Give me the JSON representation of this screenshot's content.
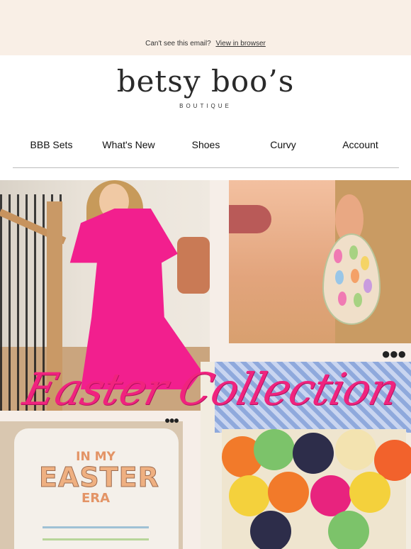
{
  "preheader": {
    "text": "Can't see this email?",
    "link": "View in browser"
  },
  "brand": {
    "name": "betsy boo’s",
    "tagline": "BOUTIQUE"
  },
  "nav": {
    "items": [
      {
        "label": "BBB Sets"
      },
      {
        "label": "What's New"
      },
      {
        "label": "Shoes"
      },
      {
        "label": "Curvy"
      },
      {
        "label": "Account"
      }
    ]
  },
  "hero": {
    "title": "Easter Collection",
    "sweatshirt_print": {
      "line1": "IN MY",
      "line2": "EASTER",
      "line3": "ERA"
    },
    "more_icon": "more-dots-icon"
  },
  "colors": {
    "header_bg": "#f9efe6",
    "accent_pink": "#f0237e"
  }
}
